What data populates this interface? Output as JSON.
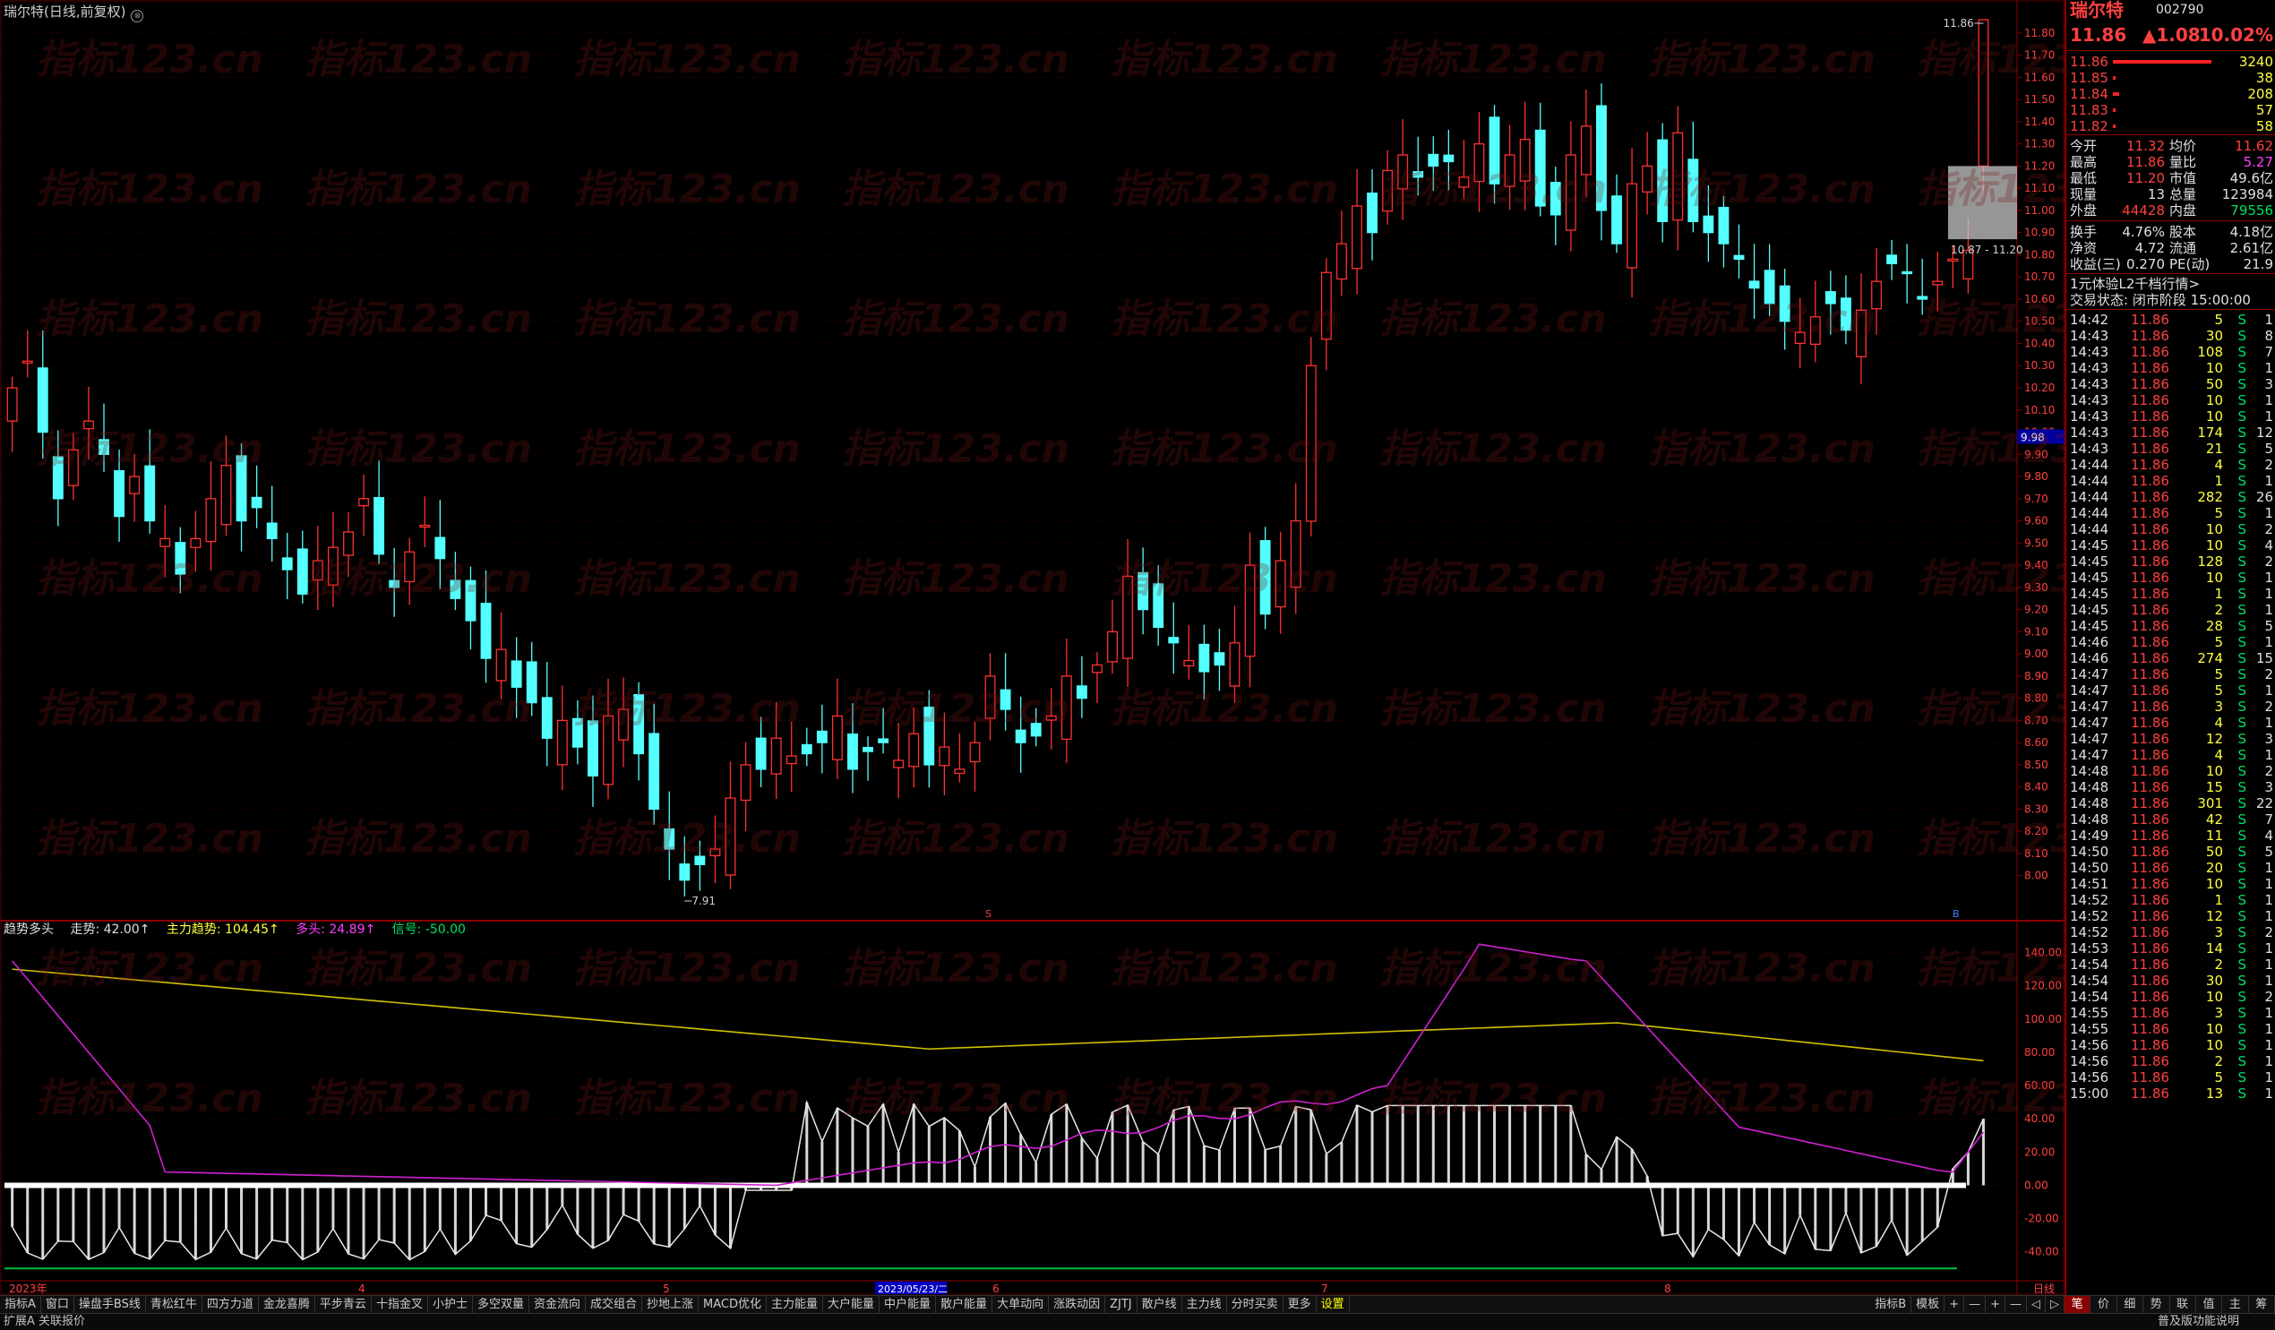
{
  "chart": {
    "title": "瑞尔特(日线,前复权)",
    "title_icon": "⊗",
    "high_label": "11.86",
    "low_label": "7.91",
    "range_label": "10.87 - 11.20",
    "last_marker": "9.98",
    "marker_s": "S",
    "marker_b": "B",
    "watermark": "指标123.cn",
    "price_axis": [
      "11.80",
      "11.70",
      "11.60",
      "11.50",
      "11.40",
      "11.30",
      "11.20",
      "11.10",
      "11.00",
      "10.90",
      "10.80",
      "10.70",
      "10.60",
      "10.50",
      "10.40",
      "10.30",
      "10.20",
      "10.10",
      "10.00",
      "9.90",
      "9.80",
      "9.70",
      "9.60",
      "9.50",
      "9.40",
      "9.30",
      "9.20",
      "9.10",
      "9.00",
      "8.90",
      "8.80",
      "8.70",
      "8.60",
      "8.50",
      "8.40",
      "8.30",
      "8.20",
      "8.10",
      "8.00"
    ],
    "ind_axis": [
      "140.00",
      "120.00",
      "100.00",
      "80.00",
      "60.00",
      "40.00",
      "20.00",
      "0.00",
      "-20.00",
      "-40.00"
    ],
    "date_labels": [
      "2023年",
      "4",
      "5",
      "2023/05/23/二",
      "6",
      "7",
      "8",
      "日线"
    ]
  },
  "indicator": {
    "name": "趋势多头",
    "trend": "走势: 42.00↑",
    "main": "主力趋势: 104.45↑",
    "bull": "多头: 24.89↑",
    "signal": "信号: -50.00"
  },
  "toolbar": {
    "left_label": "指标A",
    "items": [
      "窗口",
      "操盘手BS线",
      "青松红牛",
      "四方力道",
      "金龙喜腾",
      "平步青云",
      "十指金叉",
      "小护士",
      "多空双量",
      "资金流向",
      "成交组合",
      "抄地上涨",
      "MACD优化",
      "主力能量",
      "大户能量",
      "中户能量",
      "散户能量",
      "大单动向",
      "涨跌动因",
      "ZJTJ",
      "散户线",
      "主力线",
      "分时买卖",
      "更多",
      "设置"
    ],
    "right_items": [
      "指标B",
      "模板",
      "+",
      "—",
      "+",
      "—",
      "◁",
      "▷"
    ]
  },
  "statusbar": {
    "left": "扩展A  关联报价",
    "right": "普及版功能说明"
  },
  "panel": {
    "name": "瑞尔特",
    "code": "002790",
    "price": "11.86",
    "change": "▲1.08",
    "pct": "10.02%",
    "orderbook": [
      {
        "p": "11.86",
        "v": "3240",
        "bar": 1.0
      },
      {
        "p": "11.85",
        "v": "38",
        "bar": 0.02
      },
      {
        "p": "11.84",
        "v": "208",
        "bar": 0.06
      },
      {
        "p": "11.83",
        "v": "57",
        "bar": 0.02
      },
      {
        "p": "11.82",
        "v": "58",
        "bar": 0.02
      }
    ],
    "stats": [
      {
        "l1": "今开",
        "v1": "11.32",
        "c1": "red",
        "l2": "均价",
        "v2": "11.62",
        "c2": "red"
      },
      {
        "l1": "最高",
        "v1": "11.86",
        "c1": "red",
        "l2": "量比",
        "v2": "5.27",
        "c2": "mag"
      },
      {
        "l1": "最低",
        "v1": "11.20",
        "c1": "red",
        "l2": "市值",
        "v2": "49.6亿",
        "c2": "wht"
      },
      {
        "l1": "现量",
        "v1": "13",
        "c1": "wht",
        "l2": "总量",
        "v2": "123984",
        "c2": "wht"
      },
      {
        "l1": "外盘",
        "v1": "44428",
        "c1": "red",
        "l2": "内盘",
        "v2": "79556",
        "c2": "green"
      }
    ],
    "stats2": [
      {
        "l1": "换手",
        "v1": "4.76%",
        "l2": "股本",
        "v2": "4.18亿"
      },
      {
        "l1": "净资",
        "v1": "4.72",
        "l2": "流通",
        "v2": "2.61亿"
      },
      {
        "l1": "收益(三)",
        "v1": "0.270",
        "l2": "PE(动)",
        "v2": "21.9"
      }
    ],
    "promo": "1元体验L2千档行情>",
    "status": "交易状态: 闭市阶段 15:00:00",
    "ticks": [
      [
        "14:42",
        "11.86",
        "5",
        "S",
        "1"
      ],
      [
        "14:43",
        "11.86",
        "30",
        "S",
        "8"
      ],
      [
        "14:43",
        "11.86",
        "108",
        "S",
        "7"
      ],
      [
        "14:43",
        "11.86",
        "10",
        "S",
        "1"
      ],
      [
        "14:43",
        "11.86",
        "50",
        "S",
        "3"
      ],
      [
        "14:43",
        "11.86",
        "10",
        "S",
        "1"
      ],
      [
        "14:43",
        "11.86",
        "10",
        "S",
        "1"
      ],
      [
        "14:43",
        "11.86",
        "174",
        "S",
        "12"
      ],
      [
        "14:43",
        "11.86",
        "21",
        "S",
        "5"
      ],
      [
        "14:44",
        "11.86",
        "4",
        "S",
        "2"
      ],
      [
        "14:44",
        "11.86",
        "1",
        "S",
        "1"
      ],
      [
        "14:44",
        "11.86",
        "282",
        "S",
        "26"
      ],
      [
        "14:44",
        "11.86",
        "5",
        "S",
        "1"
      ],
      [
        "14:44",
        "11.86",
        "10",
        "S",
        "2"
      ],
      [
        "14:45",
        "11.86",
        "10",
        "S",
        "4"
      ],
      [
        "14:45",
        "11.86",
        "128",
        "S",
        "2"
      ],
      [
        "14:45",
        "11.86",
        "10",
        "S",
        "1"
      ],
      [
        "14:45",
        "11.86",
        "1",
        "S",
        "1"
      ],
      [
        "14:45",
        "11.86",
        "2",
        "S",
        "1"
      ],
      [
        "14:45",
        "11.86",
        "28",
        "S",
        "5"
      ],
      [
        "14:46",
        "11.86",
        "5",
        "S",
        "1"
      ],
      [
        "14:46",
        "11.86",
        "274",
        "S",
        "15"
      ],
      [
        "14:47",
        "11.86",
        "5",
        "S",
        "2"
      ],
      [
        "14:47",
        "11.86",
        "5",
        "S",
        "1"
      ],
      [
        "14:47",
        "11.86",
        "3",
        "S",
        "2"
      ],
      [
        "14:47",
        "11.86",
        "4",
        "S",
        "1"
      ],
      [
        "14:47",
        "11.86",
        "12",
        "S",
        "3"
      ],
      [
        "14:47",
        "11.86",
        "4",
        "S",
        "1"
      ],
      [
        "14:48",
        "11.86",
        "10",
        "S",
        "2"
      ],
      [
        "14:48",
        "11.86",
        "15",
        "S",
        "3"
      ],
      [
        "14:48",
        "11.86",
        "301",
        "S",
        "22"
      ],
      [
        "14:48",
        "11.86",
        "42",
        "S",
        "7"
      ],
      [
        "14:49",
        "11.86",
        "11",
        "S",
        "4"
      ],
      [
        "14:50",
        "11.86",
        "50",
        "S",
        "5"
      ],
      [
        "14:50",
        "11.86",
        "20",
        "S",
        "1"
      ],
      [
        "14:51",
        "11.86",
        "10",
        "S",
        "1"
      ],
      [
        "14:52",
        "11.86",
        "1",
        "S",
        "1"
      ],
      [
        "14:52",
        "11.86",
        "12",
        "S",
        "1"
      ],
      [
        "14:52",
        "11.86",
        "3",
        "S",
        "2"
      ],
      [
        "14:53",
        "11.86",
        "14",
        "S",
        "1"
      ],
      [
        "14:54",
        "11.86",
        "2",
        "S",
        "1"
      ],
      [
        "14:54",
        "11.86",
        "30",
        "S",
        "1"
      ],
      [
        "14:54",
        "11.86",
        "10",
        "S",
        "2"
      ],
      [
        "14:55",
        "11.86",
        "3",
        "S",
        "1"
      ],
      [
        "14:55",
        "11.86",
        "10",
        "S",
        "1"
      ],
      [
        "14:56",
        "11.86",
        "10",
        "S",
        "1"
      ],
      [
        "14:56",
        "11.86",
        "2",
        "S",
        "1"
      ],
      [
        "14:56",
        "11.86",
        "5",
        "S",
        "1"
      ],
      [
        "15:00",
        "11.86",
        "13",
        "S",
        "1"
      ]
    ],
    "bottom_tabs": [
      "笔",
      "价",
      "细",
      "势",
      "联",
      "值",
      "主",
      "筹"
    ]
  }
}
